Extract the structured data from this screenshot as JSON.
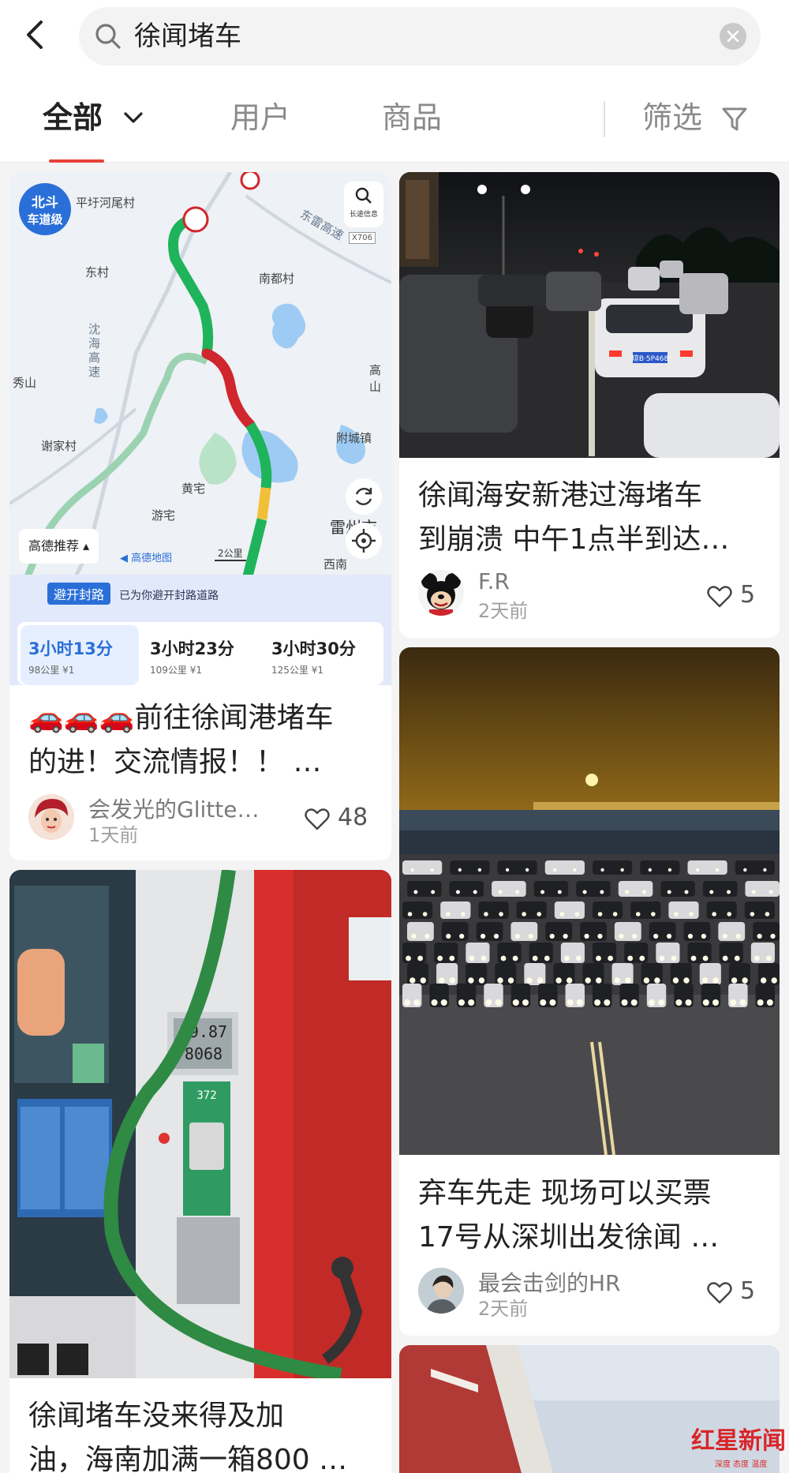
{
  "search": {
    "query": "徐闻堵车"
  },
  "tabs": {
    "all": "全部",
    "users": "用户",
    "goods": "商品",
    "filter": "筛选"
  },
  "colors": {
    "accent": "#e8413a"
  },
  "feed": {
    "card1": {
      "map": {
        "badge_line1": "北斗",
        "badge_line2": "车道级",
        "search_label": "长途信息",
        "road_code": "X706",
        "places": [
          "平圩河尾村",
          "东村",
          "南都村",
          "秀山",
          "谢家村",
          "黄宅",
          "游宅",
          "附城镇",
          "雷州市",
          "西南",
          "高山"
        ],
        "roads": [
          "东雷高速",
          "沈海高速"
        ],
        "recommend": "高德推荐",
        "brand": "高德地图",
        "scale": "2公里",
        "avoid_label": "避开封路",
        "avoid_text": "已为你避开封路道路",
        "routes": [
          {
            "time": "3小时13分",
            "meta": "98公里 ¥1"
          },
          {
            "time": "3小时23分",
            "meta": "109公里 ¥1"
          },
          {
            "time": "3小时30分",
            "meta": "125公里 ¥1"
          }
        ]
      },
      "title_line1": "🚗🚗🚗前往徐闻港堵车",
      "title_line2": "的进！交流情报！！ …",
      "author": "会发光的Glitte…",
      "time": "1天前",
      "likes": "48"
    },
    "card2": {
      "title_line1": "徐闻海安新港过海堵车",
      "title_line2": "到崩溃 中午1点半到达…",
      "author": "F.R",
      "time": "2天前",
      "likes": "5",
      "plate": "琼B·5P468"
    },
    "card3": {
      "pump_line1": "79.87",
      "pump_line2": "8068",
      "pump_line3": "372",
      "title_line1": "徐闻堵车没来得及加",
      "title_line2": "油，海南加满一箱800 …"
    },
    "card4": {
      "title_line1": "弃车先走 现场可以买票",
      "title_line2": "17号从深圳出发徐闻 …",
      "author": "最会击剑的HR",
      "time": "2天前",
      "likes": "5"
    }
  },
  "watermark": {
    "main": "红星新闻",
    "sub": "深度 态度 温度"
  }
}
